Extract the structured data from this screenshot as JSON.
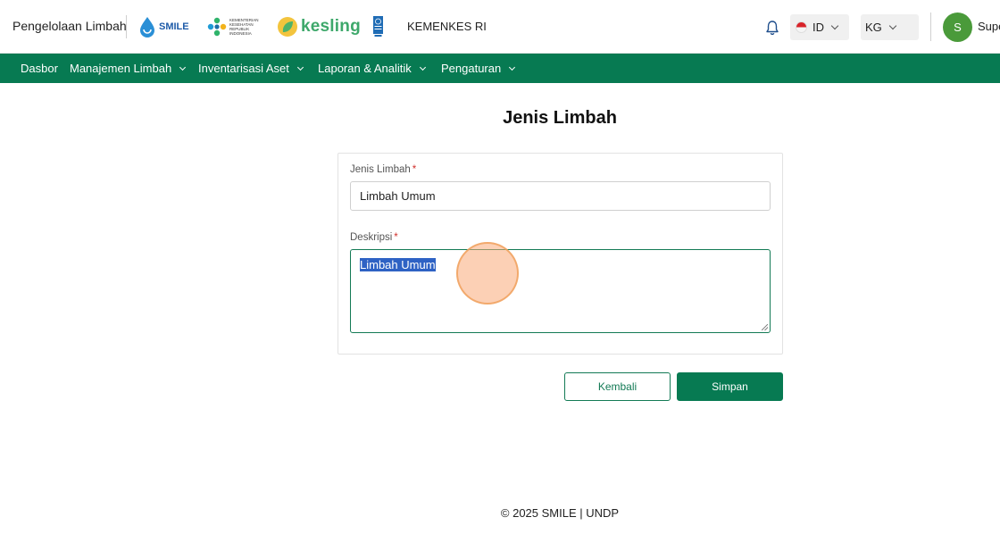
{
  "header": {
    "app_title": "Pengelolaan Limbah",
    "logos": {
      "smile": "SMILE",
      "kemenkes": "KEMENTERIAN KESEHATAN REPUBLIK INDONESIA",
      "kesling": "kesling"
    },
    "org_label": "KEMENKES RI",
    "language": "ID",
    "unit": "KG",
    "avatar_initial": "S",
    "username": "Supe"
  },
  "nav": {
    "items": [
      {
        "label": "Dasbor",
        "has_dropdown": false
      },
      {
        "label": "Manajemen Limbah",
        "has_dropdown": true
      },
      {
        "label": "Inventarisasi Aset",
        "has_dropdown": true
      },
      {
        "label": "Laporan & Analitik",
        "has_dropdown": true
      },
      {
        "label": "Pengaturan",
        "has_dropdown": true
      }
    ]
  },
  "page": {
    "title": "Jenis Limbah"
  },
  "form": {
    "jenis_label": "Jenis Limbah",
    "jenis_value": "Limbah Umum",
    "deskripsi_label": "Deskripsi",
    "deskripsi_value": "Limbah Umum",
    "required_mark": "*"
  },
  "actions": {
    "back_label": "Kembali",
    "save_label": "Simpan"
  },
  "footer": {
    "text": "© 2025 SMILE | UNDP"
  },
  "colors": {
    "primary": "#077a52",
    "required": "#d0312d",
    "selection": "#2e62c4"
  }
}
